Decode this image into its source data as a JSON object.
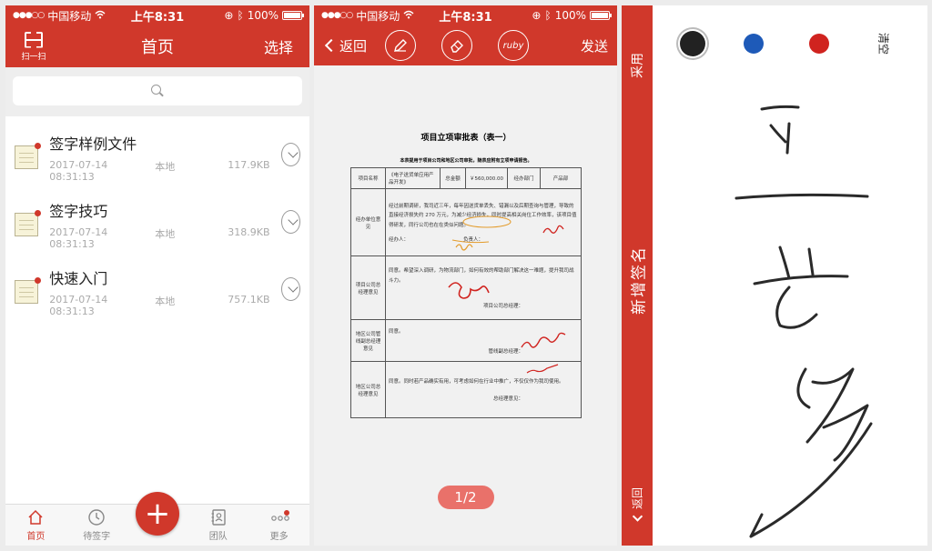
{
  "status_bar": {
    "carrier": "中国移动",
    "time": "上午8:31",
    "battery": "100%"
  },
  "home": {
    "scan_label": "扫一扫",
    "title": "首页",
    "select_label": "选择",
    "files": [
      {
        "name": "签字样例文件",
        "date": "2017-07-14 08:31:13",
        "location": "本地",
        "size": "117.9KB"
      },
      {
        "name": "签字技巧",
        "date": "2017-07-14 08:31:13",
        "location": "本地",
        "size": "318.9KB"
      },
      {
        "name": "快速入门",
        "date": "2017-07-14 08:31:13",
        "location": "本地",
        "size": "757.1KB"
      }
    ],
    "tabs": {
      "home": "首页",
      "pending": "待签字",
      "team": "团队",
      "more": "更多"
    },
    "fab": "+"
  },
  "viewer": {
    "back_label": "返回",
    "tool_ruby": "ruby",
    "send_label": "发送",
    "doc_title": "项目立项审批表（表一）",
    "doc_note": "本表提用于项目公司和地区公司审批，随表应附有立项申请报告。",
    "rows": {
      "r1": [
        "项目名称",
        "《电子送货单应用产品开发》",
        "总金额",
        "￥560,000.00",
        "经办部门",
        "产品部"
      ],
      "r2_label": "经办单位意见",
      "r2_text": "经过前期调研，我司近三年，每年因送货单丢失、错漏以及后期查询与管理，导致的直接经济损失约 270 万元，为减少经济损失，同时提高相关岗位工作效率，该项目值得研发，同行公司也在在类似问题。",
      "r2_sign": "经办人：",
      "r2_resp": "负责人：",
      "r3_label": "项目公司总经理意见",
      "r3_text": "同意。希望深入调研，为物流部门，如何有效的帮助部门解决这一难题，提升我司战斗力。",
      "r3_sign": "项目公司总经理：",
      "r4_label": "地区公司管线副总经理意见",
      "r4_text": "同意。",
      "r4_sign": "管线副总经理：",
      "r5_label": "地区公司总经理意见",
      "r5_text": "同意。同时若产品确实有用，可考虑如何在行业中推广，不仅仅作为我司使用。",
      "r5_sign": "总经理意见："
    },
    "page_indicator": "1/2"
  },
  "signature_pad": {
    "adopt_label": "采用",
    "new_signature_label": "新增签名",
    "back_label": "返回",
    "clear_label": "清空",
    "colors": {
      "black": "#222222",
      "blue": "#1e5ab8",
      "red": "#d0231f"
    }
  },
  "colors": {
    "accent": "#d0382b"
  }
}
